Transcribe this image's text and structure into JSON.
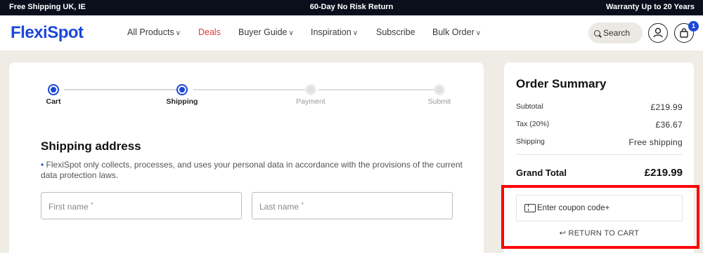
{
  "topbar": {
    "left": "Free Shipping UK, IE",
    "center": "60-Day No Risk Return",
    "right": "Warranty Up to 20 Years"
  },
  "header": {
    "logo": "FlexiSpot",
    "nav": [
      {
        "label": "All Products",
        "has_dropdown": true
      },
      {
        "label": "Deals",
        "has_dropdown": false,
        "color": "#e53935"
      },
      {
        "label": "Buyer Guide",
        "has_dropdown": true
      },
      {
        "label": "Inspiration",
        "has_dropdown": true
      },
      {
        "label": "Subscribe",
        "has_dropdown": false
      },
      {
        "label": "Bulk Order",
        "has_dropdown": true
      }
    ],
    "search_label": "Search",
    "cart_count": "1",
    "icons": {
      "search": "search-icon",
      "account": "user-icon",
      "cart": "bag-icon",
      "dropdown": "chevron-down-icon"
    }
  },
  "steps": [
    {
      "label": "Cart",
      "state": "done"
    },
    {
      "label": "Shipping",
      "state": "current"
    },
    {
      "label": "Payment",
      "state": "pending"
    },
    {
      "label": "Submit",
      "state": "pending"
    }
  ],
  "shipping": {
    "title": "Shipping address",
    "note": "FlexiSpot only collects, processes, and uses your personal data in accordance with the provisions of the current data protection laws.",
    "first_name_placeholder": "First name",
    "last_name_placeholder": "Last name",
    "required_mark": "*"
  },
  "summary": {
    "title": "Order Summary",
    "rows": [
      {
        "label": "Subtotal",
        "value": "£219.99"
      },
      {
        "label": "Tax (20%)",
        "value": "£36.67"
      },
      {
        "label": "Shipping",
        "value": "Free shipping"
      }
    ],
    "grand_total_label": "Grand Total",
    "grand_total_value": "£219.99",
    "coupon_label": "Enter coupon code+",
    "return_label": "RETURN TO CART",
    "return_arrow": "↩"
  },
  "colors": {
    "brand": "#1b47d9",
    "deals": "#e53935",
    "topbar_bg": "#0b0f1c",
    "highlight": "#ff0000",
    "page_bg": "#efece6"
  }
}
